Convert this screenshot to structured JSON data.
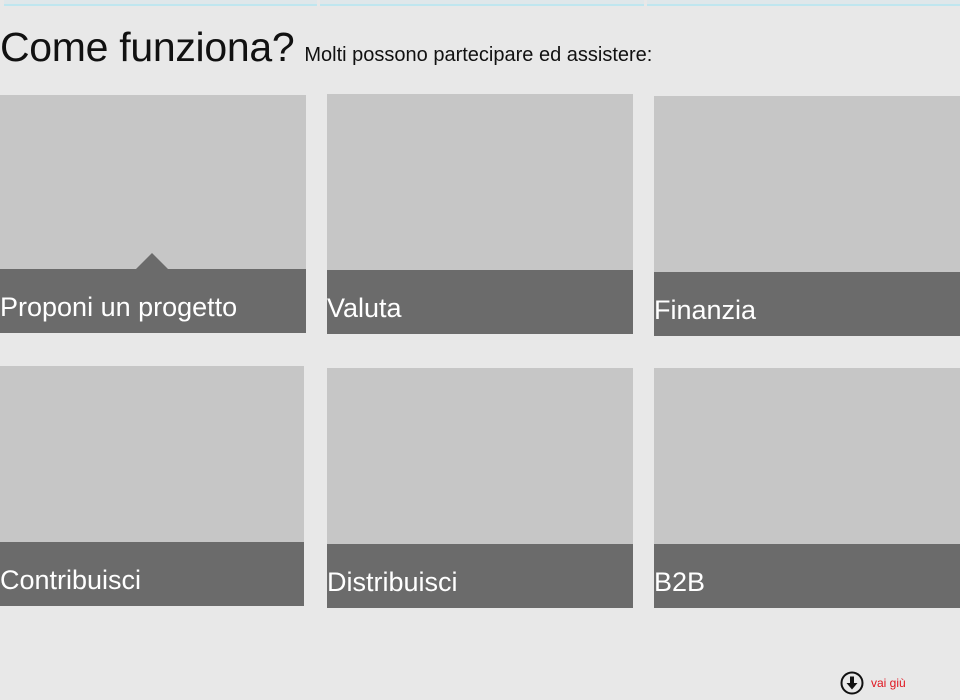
{
  "header": {
    "title": "Come funziona?",
    "subtitle": "Molti possono partecipare ed assistere:"
  },
  "cards": [
    {
      "label": "Proponi un progetto",
      "selected": true
    },
    {
      "label": "Valuta"
    },
    {
      "label": "Finanzia"
    },
    {
      "label": "Contribuisci"
    },
    {
      "label": "Distribuisci"
    },
    {
      "label": "B2B"
    }
  ],
  "scroll_down": {
    "label": "vai giù",
    "icon": "arrow-down-circle-icon",
    "color": "#e0141e"
  },
  "colors": {
    "background": "#e8e8e8",
    "card_image": "#c6c6c6",
    "card_bar": "#6b6b6b"
  }
}
